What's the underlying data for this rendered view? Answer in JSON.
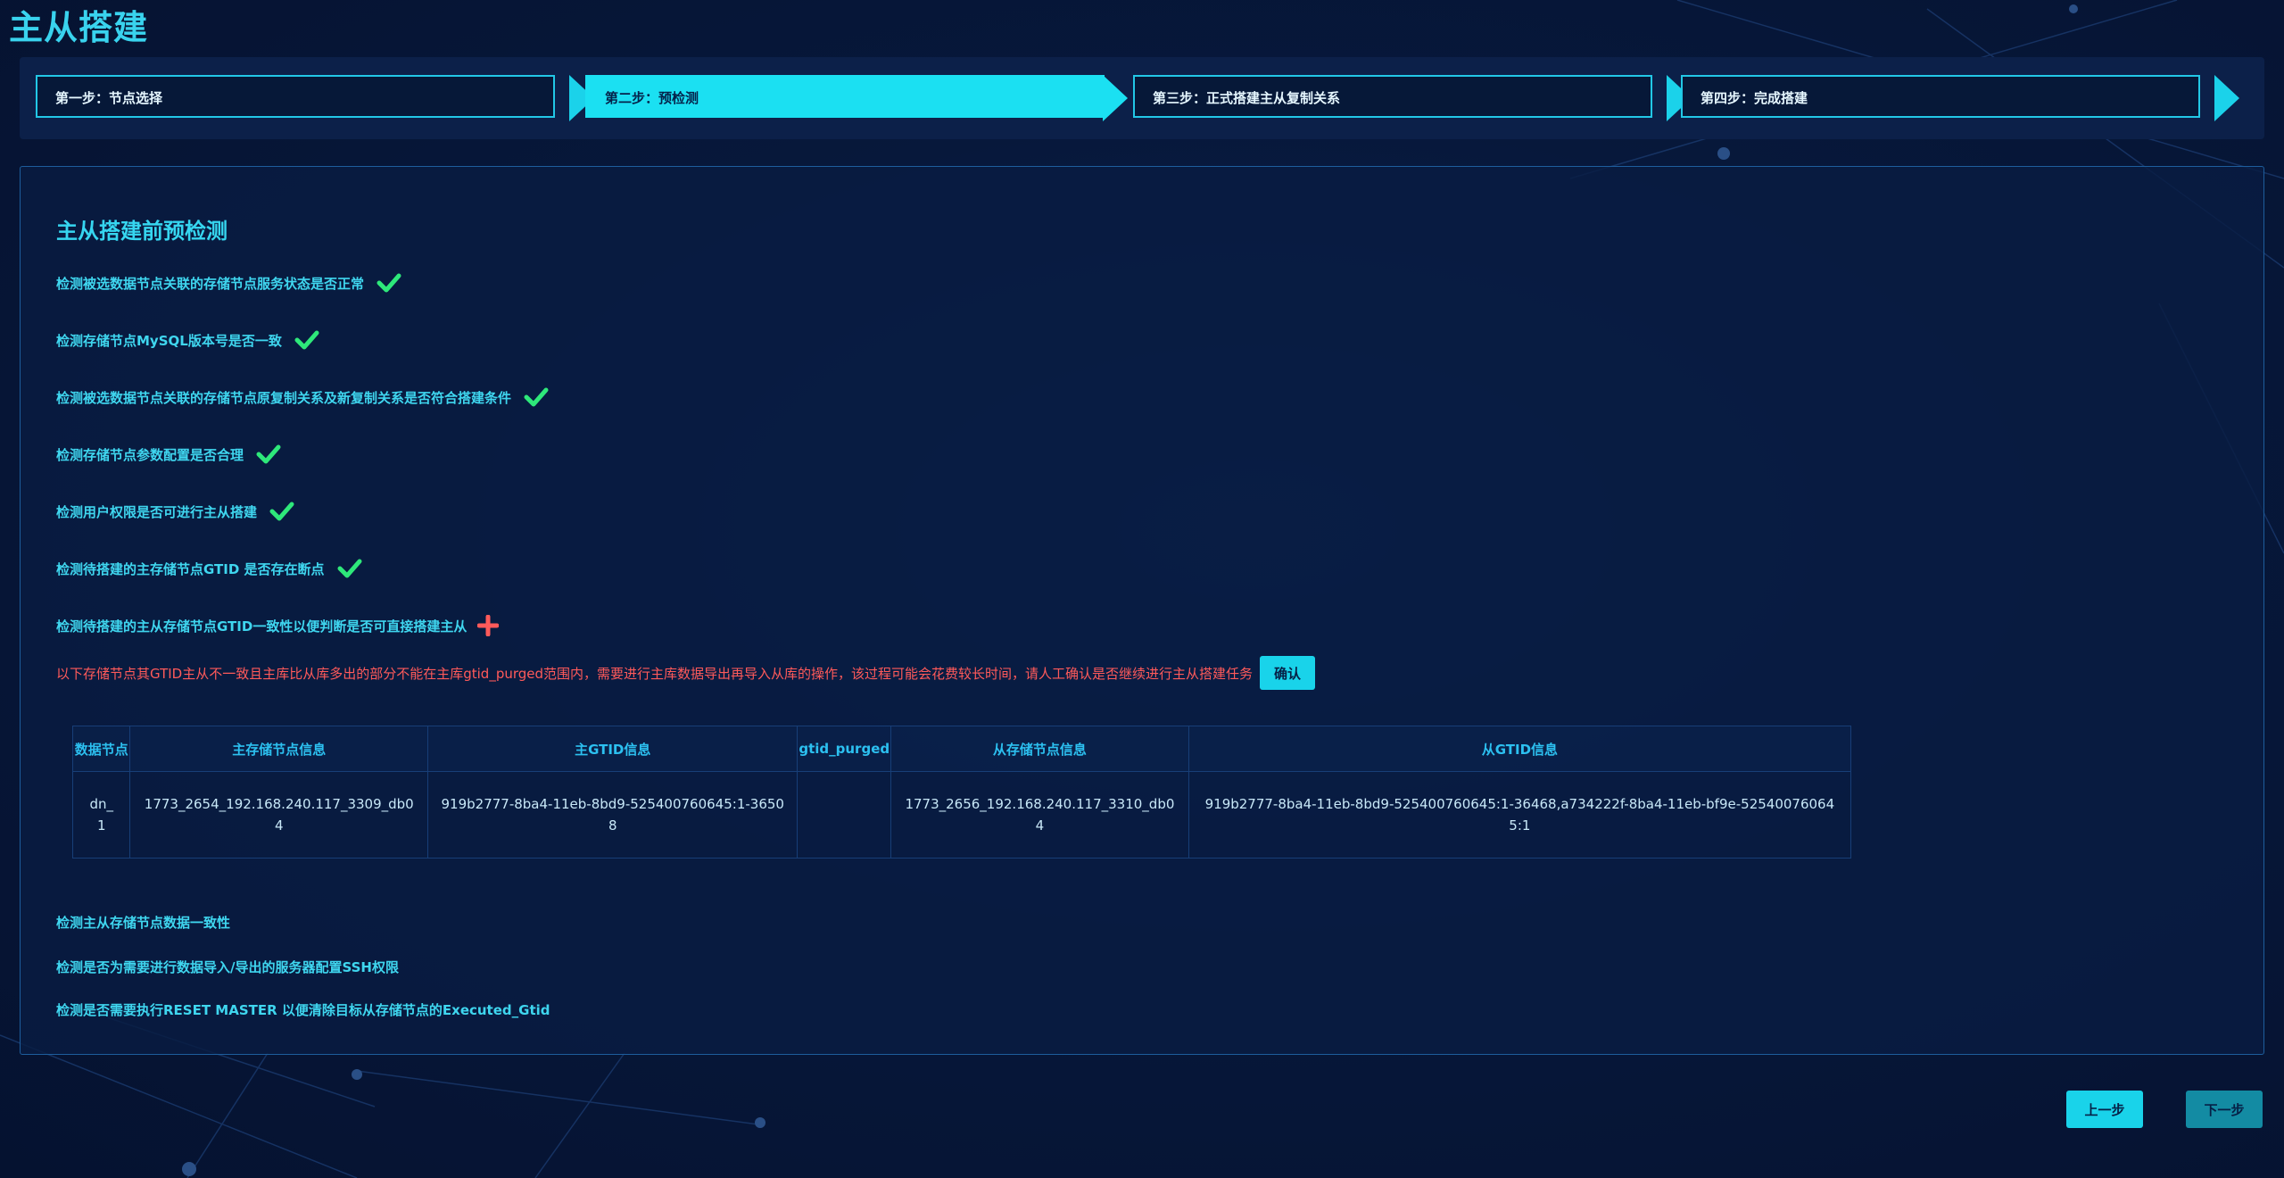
{
  "page": {
    "title": "主从搭建"
  },
  "steps": [
    {
      "label": "第一步：节点选择",
      "active": false
    },
    {
      "label": "第二步：预检测",
      "active": true
    },
    {
      "label": "第三步：正式搭建主从复制关系",
      "active": false
    },
    {
      "label": "第四步：完成搭建",
      "active": false
    }
  ],
  "panel": {
    "title": "主从搭建前预检测",
    "checks": [
      {
        "label": "检测被选数据节点关联的存储节点服务状态是否正常",
        "status": "ok"
      },
      {
        "label": "检测存储节点MySQL版本号是否一致",
        "status": "ok"
      },
      {
        "label": "检测被选数据节点关联的存储节点原复制关系及新复制关系是否符合搭建条件",
        "status": "ok"
      },
      {
        "label": "检测存储节点参数配置是否合理",
        "status": "ok"
      },
      {
        "label": "检测用户权限是否可进行主从搭建",
        "status": "ok"
      },
      {
        "label": "检测待搭建的主存储节点GTID 是否存在断点",
        "status": "ok"
      },
      {
        "label": "检测待搭建的主从存储节点GTID一致性以便判断是否可直接搭建主从",
        "status": "error"
      }
    ],
    "warning": "以下存储节点其GTID主从不一致且主库比从库多出的部分不能在主库gtid_purged范围内，需要进行主库数据导出再导入从库的操作，该过程可能会花费较长时间，请人工确认是否继续进行主从搭建任务",
    "confirm_label": "确认",
    "table": {
      "headers": [
        "数据节点",
        "主存储节点信息",
        "主GTID信息",
        "gtid_purged",
        "从存储节点信息",
        "从GTID信息"
      ],
      "rows": [
        [
          "dn_1",
          "1773_2654_192.168.240.117_3309_db04",
          "919b2777-8ba4-11eb-8bd9-525400760645:1-36508",
          "",
          "1773_2656_192.168.240.117_3310_db04",
          "919b2777-8ba4-11eb-8bd9-525400760645:1-36468,a734222f-8ba4-11eb-bf9e-525400760645:1"
        ]
      ]
    },
    "pending_checks": [
      "检测主从存储节点数据一致性",
      "检测是否为需要进行数据导入/导出的服务器配置SSH权限",
      "检测是否需要执行RESET MASTER 以便清除目标从存储节点的Executed_Gtid"
    ]
  },
  "nav": {
    "prev_label": "上一步",
    "next_label": "下一步"
  },
  "colors": {
    "accent": "#1be0f2",
    "ok": "#2ee87a",
    "error": "#ff5a5a",
    "background": "#07183b"
  }
}
